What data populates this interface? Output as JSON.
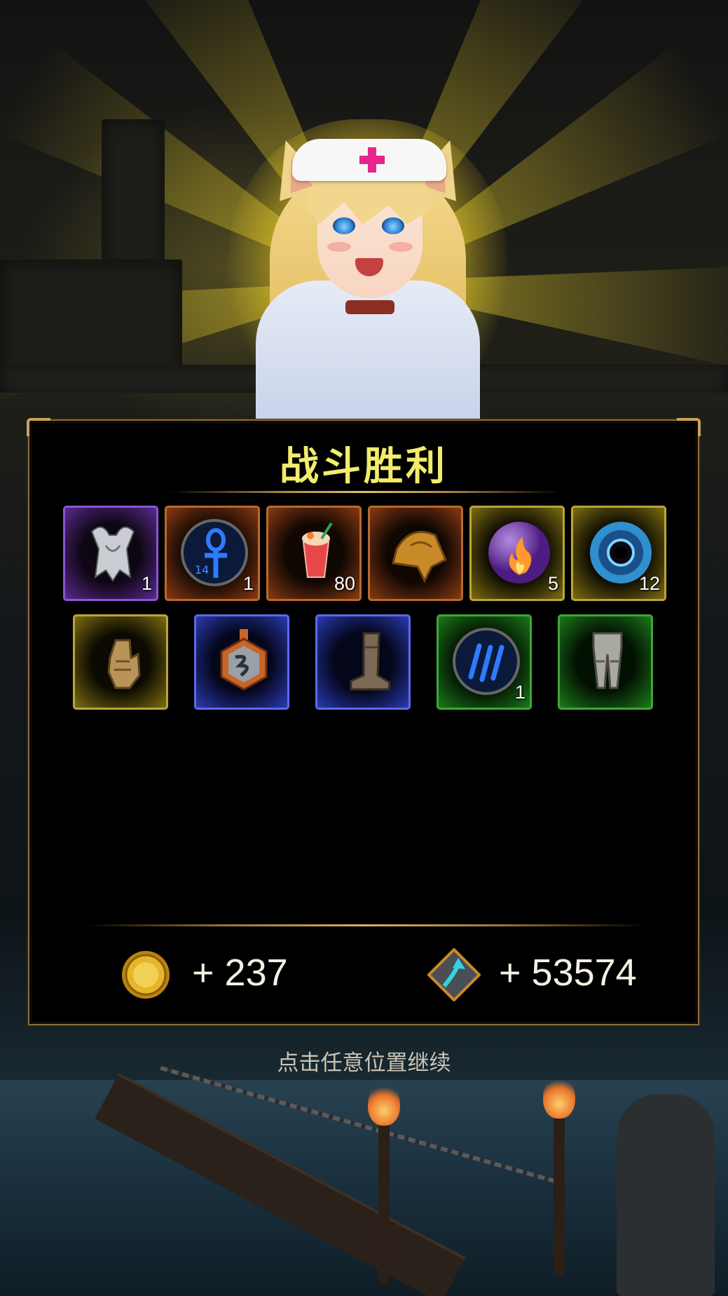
{
  "panel": {
    "title": "战斗胜利"
  },
  "items_row1": [
    {
      "icon": "winged-armor-icon",
      "quality": "purple",
      "count": "1"
    },
    {
      "icon": "ankh-rune-icon",
      "quality": "orange",
      "count": "1",
      "rune_label": "14"
    },
    {
      "icon": "cocktail-icon",
      "quality": "orange",
      "count": "80"
    },
    {
      "icon": "hood-cloak-icon",
      "quality": "orange",
      "count": ""
    },
    {
      "icon": "fire-orb-icon",
      "quality": "yellow",
      "count": "5"
    },
    {
      "icon": "void-orb-icon",
      "quality": "yellow",
      "count": "12"
    }
  ],
  "items_row2": [
    {
      "icon": "gauntlet-icon",
      "quality": "yellow",
      "count": ""
    },
    {
      "icon": "amulet-icon",
      "quality": "blue",
      "count": ""
    },
    {
      "icon": "boot-icon",
      "quality": "blue",
      "count": ""
    },
    {
      "icon": "claw-rune-icon",
      "quality": "green",
      "count": "1"
    },
    {
      "icon": "leg-armor-icon",
      "quality": "green",
      "count": ""
    }
  ],
  "rewards": {
    "gold": {
      "icon": "gold-coin-icon",
      "value": "+ 237"
    },
    "exp": {
      "icon": "exp-crystal-icon",
      "value": "+ 53574"
    }
  },
  "footer": {
    "continue_hint": "点击任意位置继续"
  },
  "colors": {
    "title": "#f2ec6b",
    "frame": "#8a6b34",
    "purple": "#8a55d6",
    "orange": "#b8692e",
    "yellow": "#b9a53b",
    "blue": "#5a6be6",
    "green": "#3fa53a"
  }
}
